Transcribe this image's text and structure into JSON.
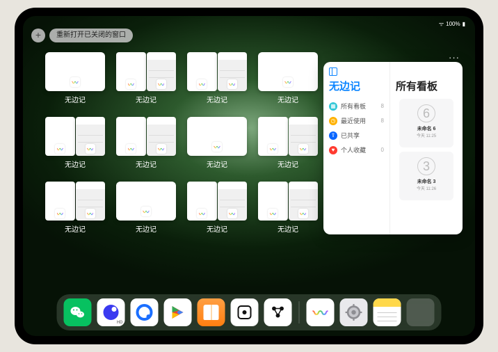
{
  "status": {
    "battery_text": "100%"
  },
  "top": {
    "plus_label": "+",
    "reopen_label": "重新打开已关闭的窗口"
  },
  "tiles": [
    {
      "label": "无边记",
      "variant": "blank"
    },
    {
      "label": "无边记",
      "variant": "split"
    },
    {
      "label": "无边记",
      "variant": "split"
    },
    {
      "label": "无边记",
      "variant": "blank"
    },
    {
      "label": "无边记",
      "variant": "split"
    },
    {
      "label": "无边记",
      "variant": "split"
    },
    {
      "label": "无边记",
      "variant": "blank"
    },
    {
      "label": "无边记",
      "variant": "split"
    },
    {
      "label": "无边记",
      "variant": "split"
    },
    {
      "label": "无边记",
      "variant": "blank"
    },
    {
      "label": "无边记",
      "variant": "split"
    },
    {
      "label": "无边记",
      "variant": "split"
    }
  ],
  "panel": {
    "more": "···",
    "left_title": "无边记",
    "right_title": "所有看板",
    "sidebar": [
      {
        "icon": "grid",
        "label": "所有看板",
        "count": "8"
      },
      {
        "icon": "clock",
        "label": "最近使用",
        "count": "8"
      },
      {
        "icon": "share",
        "label": "已共享",
        "count": ""
      },
      {
        "icon": "heart",
        "label": "个人收藏",
        "count": "0"
      }
    ],
    "boards": [
      {
        "sketch": "6",
        "name": "未命名 6",
        "sub": "今天 11:25"
      },
      {
        "sketch": "3",
        "name": "未命名 3",
        "sub": "今天 11:26"
      }
    ]
  },
  "dock": [
    {
      "id": "wechat",
      "name": "微信"
    },
    {
      "id": "quark",
      "name": "夸克"
    },
    {
      "id": "qqbrowser",
      "name": "QQ浏览器"
    },
    {
      "id": "play",
      "name": "Play"
    },
    {
      "id": "books",
      "name": "图书"
    },
    {
      "id": "dice",
      "name": "Dice"
    },
    {
      "id": "goto",
      "name": "Connect"
    },
    {
      "id": "divider"
    },
    {
      "id": "freeform",
      "name": "无边记"
    },
    {
      "id": "settings",
      "name": "设置"
    },
    {
      "id": "notes",
      "name": "备忘录"
    },
    {
      "id": "group",
      "name": "App 资源库"
    }
  ]
}
